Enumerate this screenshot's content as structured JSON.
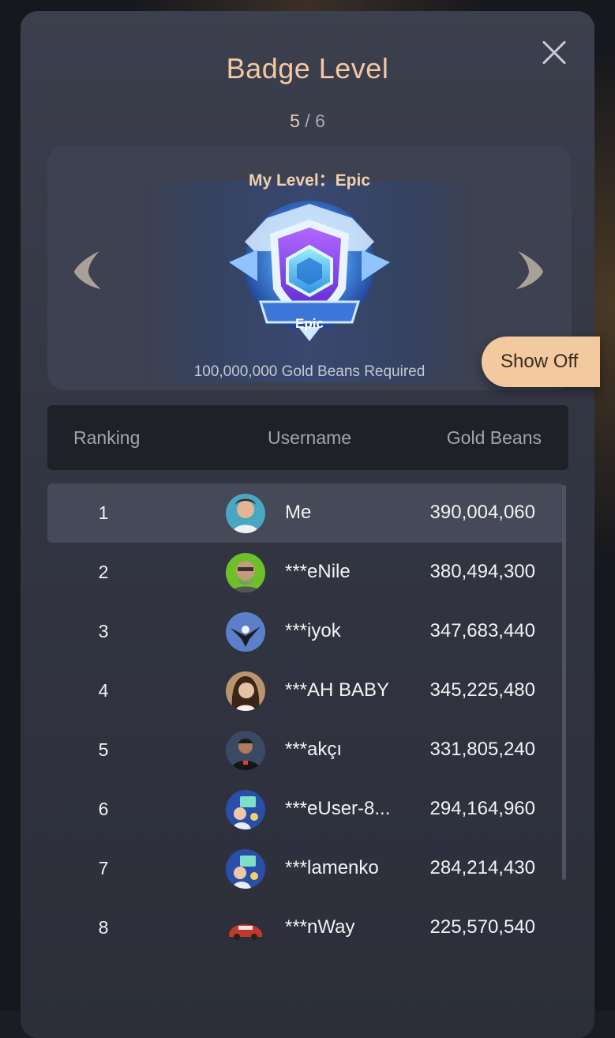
{
  "dialog": {
    "title": "Badge Level",
    "page_current": "5",
    "page_separator": " / ",
    "page_total": "6"
  },
  "hero": {
    "my_level_label": "My Level：",
    "my_level_value": "Epic",
    "badge_label": "Epic",
    "requirement": "100,000,000 Gold Beans Required",
    "prev_icon": "chevron-left-icon",
    "next_icon": "chevron-right-icon"
  },
  "show_off_label": "Show Off",
  "table": {
    "headers": {
      "ranking": "Ranking",
      "username": "Username",
      "gold_beans": "Gold Beans"
    },
    "rows": [
      {
        "rank": "1",
        "username": "Me",
        "beans": "390,004,060",
        "avatar_color": "#4aa7c2"
      },
      {
        "rank": "2",
        "username": "***eNile",
        "beans": "380,494,300",
        "avatar_color": "#6fbf2a"
      },
      {
        "rank": "3",
        "username": "***iyok",
        "beans": "347,683,440",
        "avatar_color": "#5b7fc9"
      },
      {
        "rank": "4",
        "username": "***AH BABY",
        "beans": "345,225,480",
        "avatar_color": "#b8956e"
      },
      {
        "rank": "5",
        "username": "***akçı",
        "beans": "331,805,240",
        "avatar_color": "#3a4a62"
      },
      {
        "rank": "6",
        "username": "***eUser-8...",
        "beans": "294,164,960",
        "avatar_color": "#2a4fa8"
      },
      {
        "rank": "7",
        "username": "***lamenko",
        "beans": "284,214,430",
        "avatar_color": "#2a4fa8"
      },
      {
        "rank": "8",
        "username": "***nWay",
        "beans": "225,570,540",
        "avatar_color": "#c9c9c9"
      }
    ]
  },
  "colors": {
    "accent": "#f3c9a3",
    "show_off_bg": "#f3c9a0",
    "row_highlight": "#454958"
  }
}
